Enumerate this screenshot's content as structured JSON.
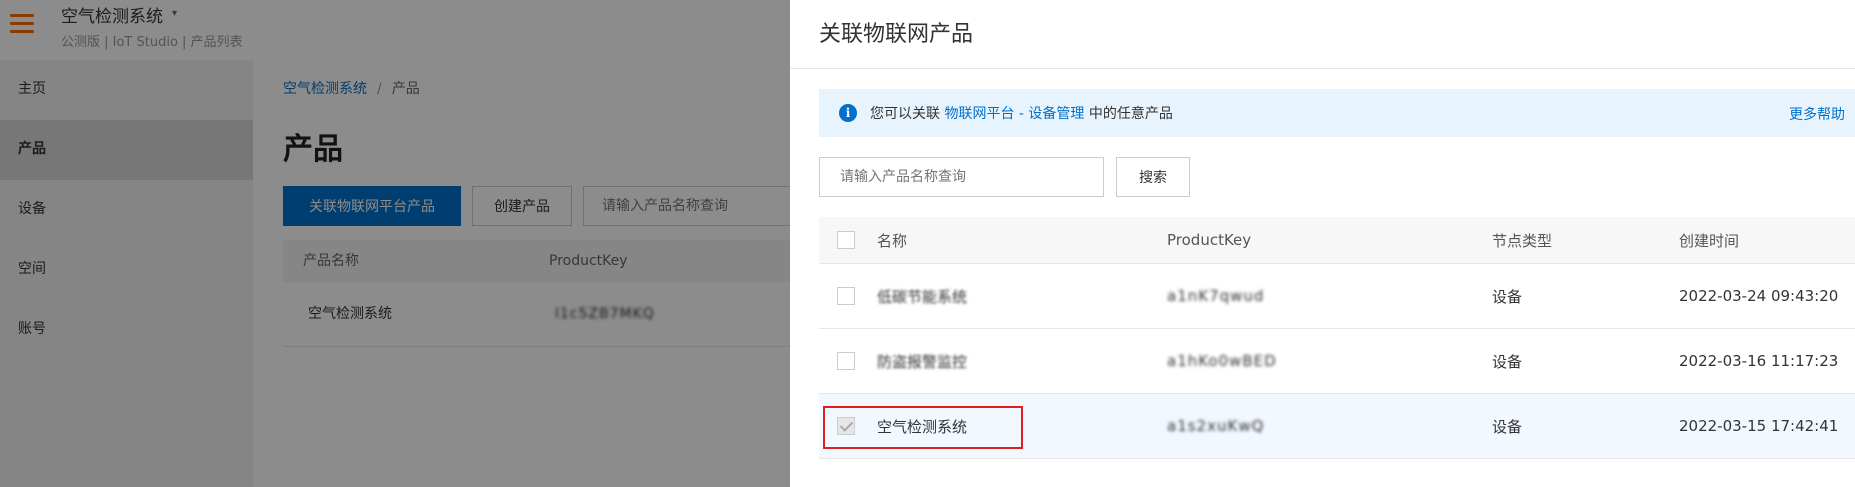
{
  "app": {
    "title": "空气检测系统",
    "caret": "▾",
    "subtitle": "公测版 | IoT Studio | 产品列表",
    "brand_color": "#ff6a00"
  },
  "sidebar": {
    "items": [
      {
        "label": "主页",
        "active": false
      },
      {
        "label": "产品",
        "active": true
      },
      {
        "label": "设备",
        "active": false
      },
      {
        "label": "空间",
        "active": false
      },
      {
        "label": "账号",
        "active": false
      }
    ]
  },
  "main": {
    "breadcrumb": {
      "root": "空气检测系统",
      "separator": "/",
      "current": "产品"
    },
    "page_title": "产品",
    "primary_button": "关联物联网平台产品",
    "create_button": "创建产品",
    "search_placeholder": "请输入产品名称查询",
    "table": {
      "headers": {
        "name": "产品名称",
        "key": "ProductKey"
      },
      "rows": [
        {
          "name": "空气检测系统",
          "key": "l1c5ZB7MKQ"
        }
      ]
    }
  },
  "drawer": {
    "title": "关联物联网产品",
    "notice": {
      "prefix": "您可以关联",
      "link": "物联网平台 - 设备管理",
      "suffix": "中的任意产品",
      "more": "更多帮助",
      "icon": "info-icon",
      "color": "#0070cc",
      "bg_color": "#e8f4fd"
    },
    "search": {
      "placeholder": "请输入产品名称查询",
      "button": "搜索"
    },
    "table": {
      "headers": {
        "name": "名称",
        "key": "ProductKey",
        "type": "节点类型",
        "time": "创建时间"
      },
      "rows": [
        {
          "name": "低碳节能系统",
          "key": "a1nK7qwud",
          "type": "设备",
          "time": "2022-03-24 09:43:20",
          "checked": false,
          "blurred": true
        },
        {
          "name": "防盗报警监控",
          "key": "a1hKo0wBED",
          "type": "设备",
          "time": "2022-03-16 11:17:23",
          "checked": false,
          "blurred": true
        },
        {
          "name": "空气检测系统",
          "key": "a1s2xuKwQ",
          "type": "设备",
          "time": "2022-03-15 17:42:41",
          "checked": true,
          "blurred": false
        }
      ]
    },
    "highlight_color": "#e02020"
  }
}
